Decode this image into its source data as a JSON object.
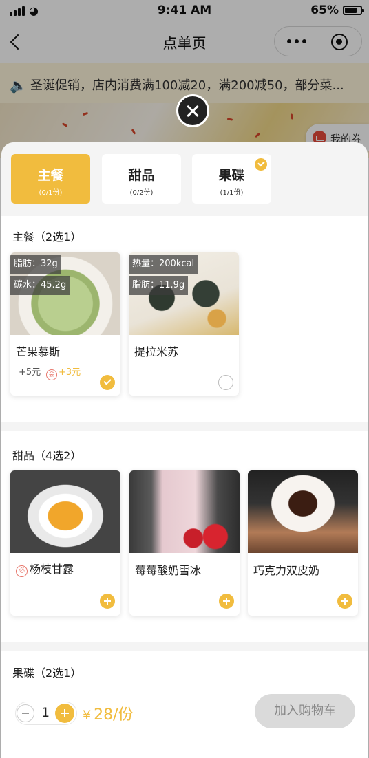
{
  "status_bar": {
    "time": "9:41 AM",
    "battery": "65%"
  },
  "nav": {
    "title": "点单页"
  },
  "notice": {
    "text": "圣诞促销，店内消费满100减20，满200减50，部分菜..."
  },
  "coupon": {
    "label": "我的券"
  },
  "tabs": [
    {
      "name": "主餐",
      "count": "(0/1份)",
      "active": true,
      "checked": false
    },
    {
      "name": "甜品",
      "count": "(0/2份)",
      "active": false,
      "checked": false
    },
    {
      "name": "果碟",
      "count": "(1/1份)",
      "active": false,
      "checked": true
    }
  ],
  "sections": {
    "main": {
      "title": "主餐（2选1）",
      "items": [
        {
          "name": "芒果慕斯",
          "nutrition": [
            "脂肪：32g",
            "碳水：45.2g"
          ],
          "extra_price": "+5元",
          "promo_tag": "会",
          "promo_price": "+3元",
          "selected": true
        },
        {
          "name": "提拉米苏",
          "nutrition": [
            "热量：200kcal",
            "脂肪：11.9g"
          ],
          "selected": false
        }
      ]
    },
    "dessert": {
      "title": "甜品（4选2）",
      "items": [
        {
          "name": "杨枝甘露",
          "tag": "必"
        },
        {
          "name": "莓莓酸奶雪冰"
        },
        {
          "name": "巧克力双皮奶"
        }
      ]
    },
    "fruit": {
      "title": "果碟（2选1）"
    }
  },
  "footer": {
    "quantity": "1",
    "currency": "¥",
    "price": "28/份",
    "add_to_cart": "加入购物车"
  },
  "colors": {
    "accent": "#f1bc3e",
    "disabled_button": "#dadada"
  }
}
